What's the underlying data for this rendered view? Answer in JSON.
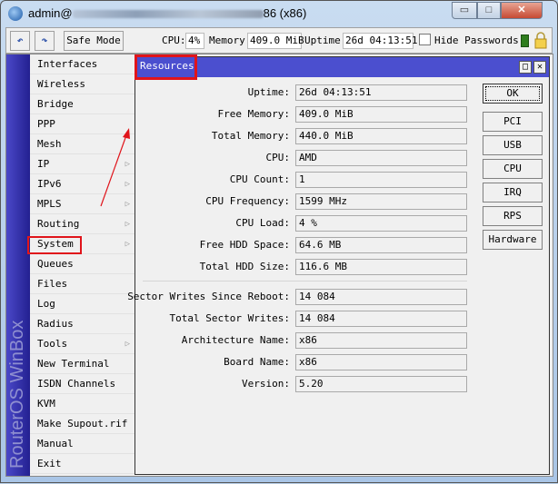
{
  "window": {
    "title_prefix": "admin@",
    "title_suffix": "86 (x86)",
    "minimize": "▭",
    "maximize": "□",
    "close": "✕"
  },
  "toolbar": {
    "undo": "↶",
    "redo": "↷",
    "safe_mode": "Safe Mode",
    "cpu_label": "CPU:",
    "cpu_value": "4%",
    "memory_label": "Memory:",
    "memory_value": "409.0 MiB",
    "uptime_label": "Uptime:",
    "uptime_value": "26d 04:13:51",
    "hide_passwords": "Hide Passwords",
    "hide_passwords_checked": false
  },
  "brand": "RouterOS WinBox",
  "menu": [
    {
      "label": "Interfaces",
      "submenu": false
    },
    {
      "label": "Wireless",
      "submenu": false
    },
    {
      "label": "Bridge",
      "submenu": false
    },
    {
      "label": "PPP",
      "submenu": false
    },
    {
      "label": "Mesh",
      "submenu": false
    },
    {
      "label": "IP",
      "submenu": true
    },
    {
      "label": "IPv6",
      "submenu": true
    },
    {
      "label": "MPLS",
      "submenu": true
    },
    {
      "label": "Routing",
      "submenu": true
    },
    {
      "label": "System",
      "submenu": true
    },
    {
      "label": "Queues",
      "submenu": false
    },
    {
      "label": "Files",
      "submenu": false
    },
    {
      "label": "Log",
      "submenu": false
    },
    {
      "label": "Radius",
      "submenu": false
    },
    {
      "label": "Tools",
      "submenu": true
    },
    {
      "label": "New Terminal",
      "submenu": false
    },
    {
      "label": "ISDN Channels",
      "submenu": false
    },
    {
      "label": "KVM",
      "submenu": false
    },
    {
      "label": "Make Supout.rif",
      "submenu": false
    },
    {
      "label": "Manual",
      "submenu": false
    },
    {
      "label": "Exit",
      "submenu": false
    }
  ],
  "resources": {
    "title": "Resources",
    "fields1": [
      {
        "label": "Uptime:",
        "value": "26d 04:13:51"
      },
      {
        "label": "Free Memory:",
        "value": "409.0 MiB"
      },
      {
        "label": "Total Memory:",
        "value": "440.0 MiB"
      },
      {
        "label": "CPU:",
        "value": "AMD"
      },
      {
        "label": "CPU Count:",
        "value": "1"
      },
      {
        "label": "CPU Frequency:",
        "value": "1599 MHz"
      },
      {
        "label": "CPU Load:",
        "value": "4 %"
      },
      {
        "label": "Free HDD Space:",
        "value": "64.6 MB"
      },
      {
        "label": "Total HDD Size:",
        "value": "116.6 MB"
      }
    ],
    "fields2": [
      {
        "label": "Sector Writes Since Reboot:",
        "value": "14 084"
      },
      {
        "label": "Total Sector Writes:",
        "value": "14 084"
      },
      {
        "label": "Architecture Name:",
        "value": "x86"
      },
      {
        "label": "Board Name:",
        "value": "x86"
      },
      {
        "label": "Version:",
        "value": "5.20"
      }
    ],
    "buttons": [
      "OK",
      "PCI",
      "USB",
      "CPU",
      "IRQ",
      "RPS",
      "Hardware"
    ]
  },
  "colors": {
    "highlight": "#e0141b",
    "header": "#4b4fcf"
  }
}
